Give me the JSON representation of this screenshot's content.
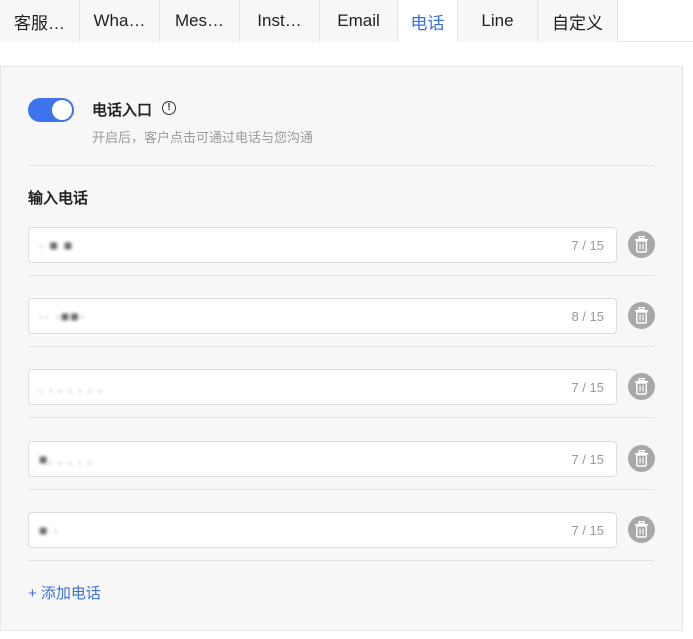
{
  "tabs": [
    {
      "label": "客服…"
    },
    {
      "label": "Wha…"
    },
    {
      "label": "Mes…"
    },
    {
      "label": "Inst…"
    },
    {
      "label": "Email"
    },
    {
      "label": "电话"
    },
    {
      "label": "Line"
    },
    {
      "label": "自定义"
    }
  ],
  "active_tab": "电话",
  "phone_entry": {
    "toggle_on": true,
    "title": "电话入口",
    "info_glyph": "!",
    "description": "开启后，客户点击可通过电话与您沟通"
  },
  "input_section": {
    "label": "输入电话",
    "fields": [
      {
        "value": "· ■ ■",
        "counter": "7 / 15"
      },
      {
        "value": "·· ·■■·",
        "counter": "8 / 15"
      },
      {
        "value": ". . . . . . .",
        "counter": "7 / 15"
      },
      {
        "value": "■. . . . .",
        "counter": "7 / 15"
      },
      {
        "value": "■ ·",
        "counter": "7 / 15"
      }
    ]
  },
  "add_link": "+ 添加电话",
  "colors": {
    "accent": "#3b6fe0",
    "toggle": "#3f73ec",
    "trash": "#a8a8a8"
  },
  "icons": {
    "info": "info-icon",
    "delete": "trash-icon"
  }
}
